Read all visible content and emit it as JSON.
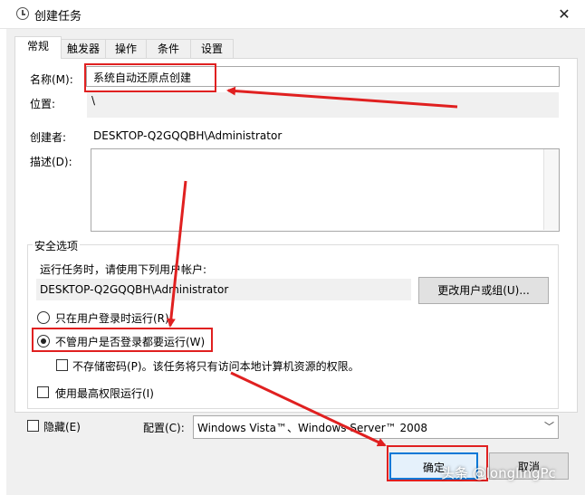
{
  "window": {
    "title": "创建任务",
    "close_glyph": "✕"
  },
  "tabs": [
    "常规",
    "触发器",
    "操作",
    "条件",
    "设置"
  ],
  "general": {
    "name_label": "名称(M):",
    "name_value": "系统自动还原点创建",
    "location_label": "位置:",
    "location_value": "\\",
    "author_label": "创建者:",
    "author_value": "DESKTOP-Q2GQQBH\\Administrator",
    "description_label": "描述(D):"
  },
  "security": {
    "group_title": "安全选项",
    "run_as_label": "运行任务时，请使用下列用户帐户:",
    "run_as_value": "DESKTOP-Q2GQQBH\\Administrator",
    "change_user_button": "更改用户或组(U)...",
    "radio_logged_on": "只在用户登录时运行(R)",
    "radio_always": "不管用户是否登录都要运行(W)",
    "radio_selected": "always",
    "no_store_password": "不存储密码(P)。该任务将只有访问本地计算机资源的权限。",
    "run_highest": "使用最高权限运行(I)"
  },
  "bottom": {
    "hidden_label": "隐藏(E)",
    "config_label": "配置(C):",
    "config_value": "Windows Vista™、Windows Server™ 2008",
    "ok_button": "确定",
    "cancel_button": "取消"
  },
  "watermark": "头条 @longlingPc",
  "colors": {
    "annotation": "#e02020",
    "focus": "#0078d7"
  }
}
